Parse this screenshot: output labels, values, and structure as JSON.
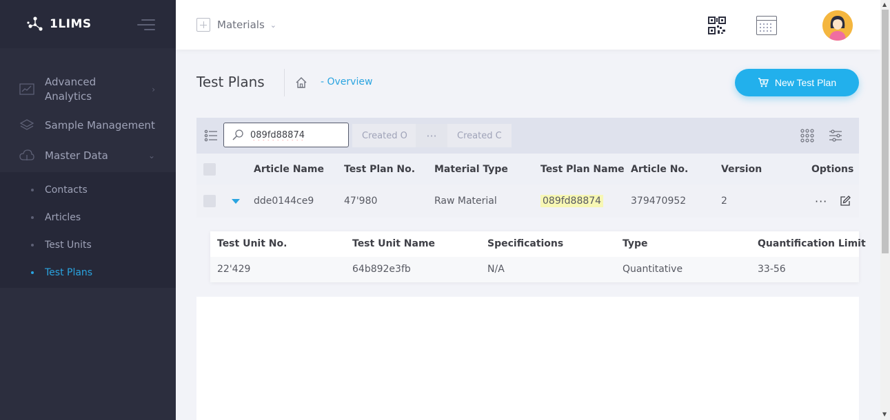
{
  "app": {
    "brand": "1LIMS"
  },
  "sidebar": {
    "items": [
      {
        "label": "Advanced Analytics"
      },
      {
        "label": "Sample Management"
      },
      {
        "label": "Master Data"
      }
    ],
    "submenu": [
      {
        "label": "Contacts"
      },
      {
        "label": "Articles"
      },
      {
        "label": "Test Units"
      },
      {
        "label": "Test Plans",
        "active": true
      }
    ]
  },
  "header": {
    "module": "Materials"
  },
  "page": {
    "title": "Test Plans",
    "breadcrumb": "- Overview",
    "new_button": "New Test Plan"
  },
  "toolbar": {
    "search_value": "089fd88874",
    "filter1": "Created O",
    "filter_more": "···",
    "filter2": "Created C"
  },
  "table": {
    "columns": [
      "Article Name",
      "Test Plan No.",
      "Material Type",
      "Test Plan Name",
      "Article No.",
      "Version",
      "Options"
    ],
    "rows": [
      {
        "article_name": "dde0144ce9",
        "test_plan_no": "47'980",
        "material_type": "Raw Material",
        "test_plan_name": "089fd88874",
        "article_no": "379470952",
        "version": "2",
        "options": "···"
      }
    ]
  },
  "detail": {
    "columns": [
      "Test Unit No.",
      "Test Unit Name",
      "Specifications",
      "Type",
      "Quantification Limit"
    ],
    "rows": [
      {
        "unit_no": "22'429",
        "unit_name": "64b892e3fb",
        "specs": "N/A",
        "type": "Quantitative",
        "limit": "33-56"
      }
    ]
  },
  "colors": {
    "accent": "#2aa4e0",
    "sidebar": "#2c2e3e",
    "button": "#22b0ec",
    "highlight": "#f7f7b4"
  }
}
